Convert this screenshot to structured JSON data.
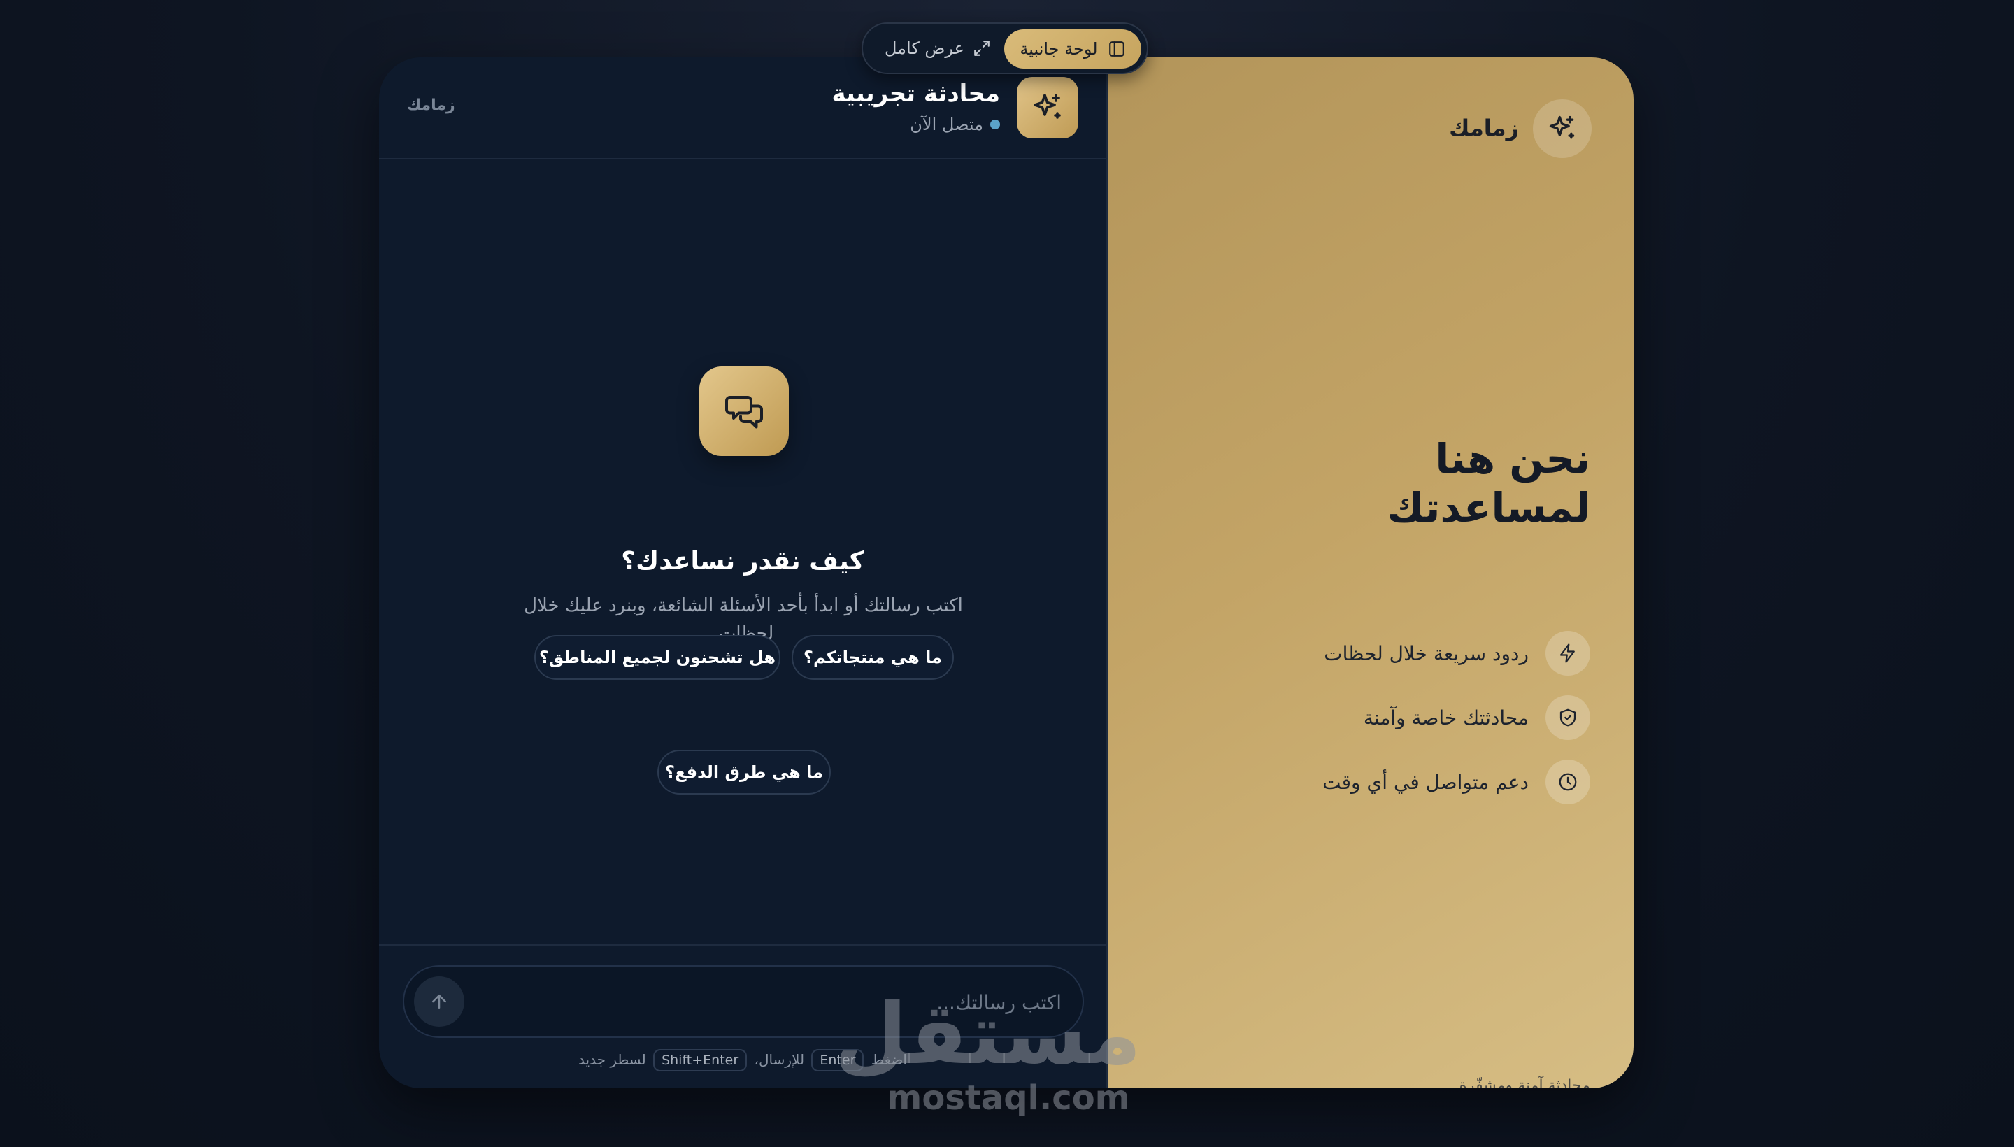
{
  "view_toggle": {
    "full_label": "عرض كامل",
    "side_label": "لوحة جانبية",
    "active": "side"
  },
  "chat": {
    "title": "محادثة تجريبية",
    "status": "متصل الآن",
    "brand": "زمامك",
    "empty_title": "كيف نقدر نساعدك؟",
    "empty_subtitle": "اكتب رسالتك أو ابدأ بأحد الأسئلة الشائعة، وبنرد عليك خلال لحظات.",
    "suggestions": [
      "ما هي منتجاتكم؟",
      "هل تشحنون لجميع المناطق؟",
      "ما هي طرق الدفع؟"
    ],
    "input_placeholder": "اكتب رسالتك...",
    "hint": {
      "press": "اضغط",
      "key_send": "Enter",
      "send_text": "للإرسال،",
      "key_newline": "Shift+Enter",
      "newline_text": "لسطر جديد"
    }
  },
  "info": {
    "brand": "زمامك",
    "headline_line1": "نحن هنا",
    "headline_line2": "لمساعدتك",
    "features": [
      {
        "icon": "lightning-icon",
        "label": "ردود سريعة خلال لحظات"
      },
      {
        "icon": "shield-check-icon",
        "label": "محادثتك خاصة وآمنة"
      },
      {
        "icon": "clock-icon",
        "label": "دعم متواصل في أي وقت"
      }
    ],
    "footer": "محادثة آمنة ومشفّرة"
  },
  "watermark": {
    "arabic": "مستقل",
    "latin": "mostaql.com"
  },
  "colors": {
    "gold": "#c6a45e",
    "navy": "#0e1a2c",
    "status_dot": "#5ba3c9"
  }
}
